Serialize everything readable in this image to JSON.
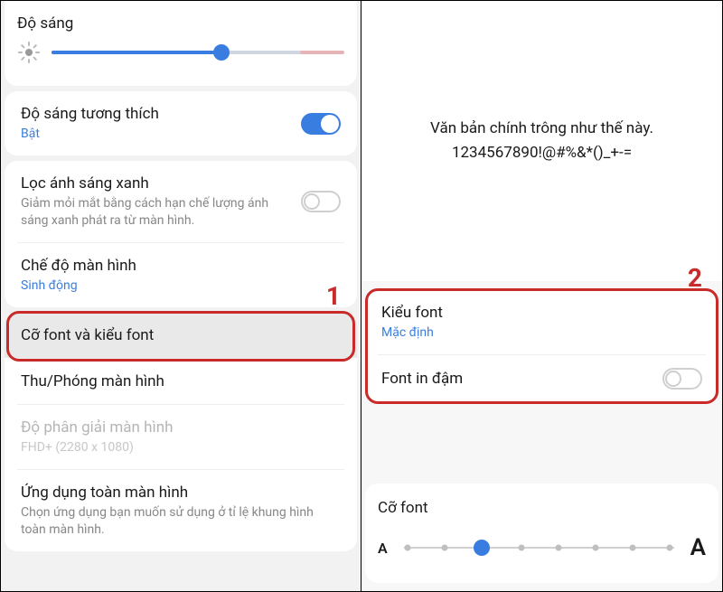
{
  "left": {
    "brightness_label": "Độ sáng",
    "adaptive": {
      "title": "Độ sáng tương thích",
      "status": "Bật"
    },
    "bluelight": {
      "title": "Lọc ánh sáng xanh",
      "sub": "Giảm mỏi mắt bằng cách hạn chế lượng ánh sáng xanh phát ra từ màn hình."
    },
    "screenmode": {
      "title": "Chế độ màn hình",
      "status": "Sinh động"
    },
    "fontsize_style": "Cỡ font và kiểu font",
    "zoom": "Thu/Phóng màn hình",
    "resolution": {
      "title": "Độ phân giải màn hình",
      "sub": "FHD+ (2280 x 1080)"
    },
    "fullscreen": {
      "title": "Ứng dụng toàn màn hình",
      "sub": "Chọn ứng dụng bạn muốn sử dụng ở tỉ lệ khung hình toàn màn hình."
    }
  },
  "right": {
    "preview_line1": "Văn bản chính trông như thế này.",
    "preview_line2": "1234567890!@#%&*()_+-=",
    "fontstyle": {
      "title": "Kiểu font",
      "status": "Mặc định"
    },
    "bold": "Font in đậm",
    "fontsize_label": "Cỡ font"
  },
  "annotations": {
    "step1": "1",
    "step2": "2"
  }
}
